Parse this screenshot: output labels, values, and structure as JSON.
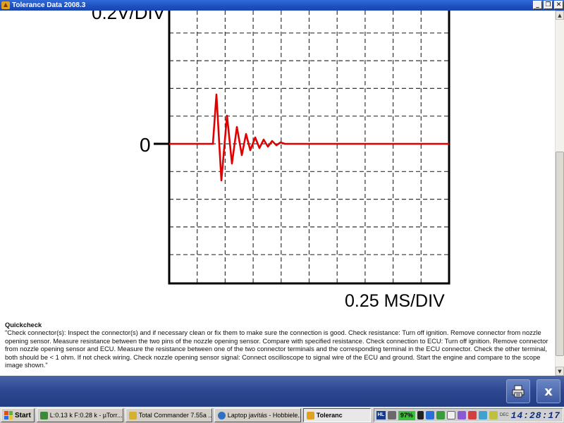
{
  "window": {
    "title": "Tolerance Data 2008.3",
    "buttons": {
      "minimize": "_",
      "restore": "❐",
      "close": "✕"
    }
  },
  "scope": {
    "y_label": "0.2V/DIV",
    "x_label": "0.25 MS/DIV",
    "zero_label": "0",
    "signal_color": "#e00000",
    "grid_color": "#333333"
  },
  "quickcheck": {
    "title": "Quickcheck",
    "text": "\"Check connector(s): Inspect the connector(s) and if necessary clean or fix them to make sure the connection is good. Check resistance: Turn off ignition. Remove connector from nozzle opening sensor. Measure resistance between the two pins of the nozzle opening sensor. Compare with specified resistance. Check connection to ECU: Turn off ignition. Remove connector from nozzle opening sensor and ECU. Measure the resistance between one of the two connector terminals and the corresponding terminal in the ECU connector. Check the other terminal, both should be < 1 ohm. If not check wiring. Check nozzle opening sensor signal: Connect oscilloscope to signal wire of the ECU and ground. Start the engine and compare to the scope image shown.\""
  },
  "toolbar": {
    "print_icon": "print-icon",
    "close_label": "x"
  },
  "taskbar": {
    "start_label": "Start",
    "tasks": [
      {
        "label": "L:0.13 k F:0.28 k - µTorr...",
        "icon_color": "#3a8a3a"
      },
      {
        "label": "Total Commander 7.55a ...",
        "icon_color": "#d8b030"
      },
      {
        "label": "Laptop javítás - Hobbiele...",
        "icon_color": "#3070c0"
      },
      {
        "label": "Toleranc",
        "icon_color": "#e0a020",
        "active": true
      }
    ],
    "tray": {
      "hl_label": "HL",
      "battery": "97%",
      "date_label": "DEC",
      "clock": "14:28:17"
    }
  }
}
